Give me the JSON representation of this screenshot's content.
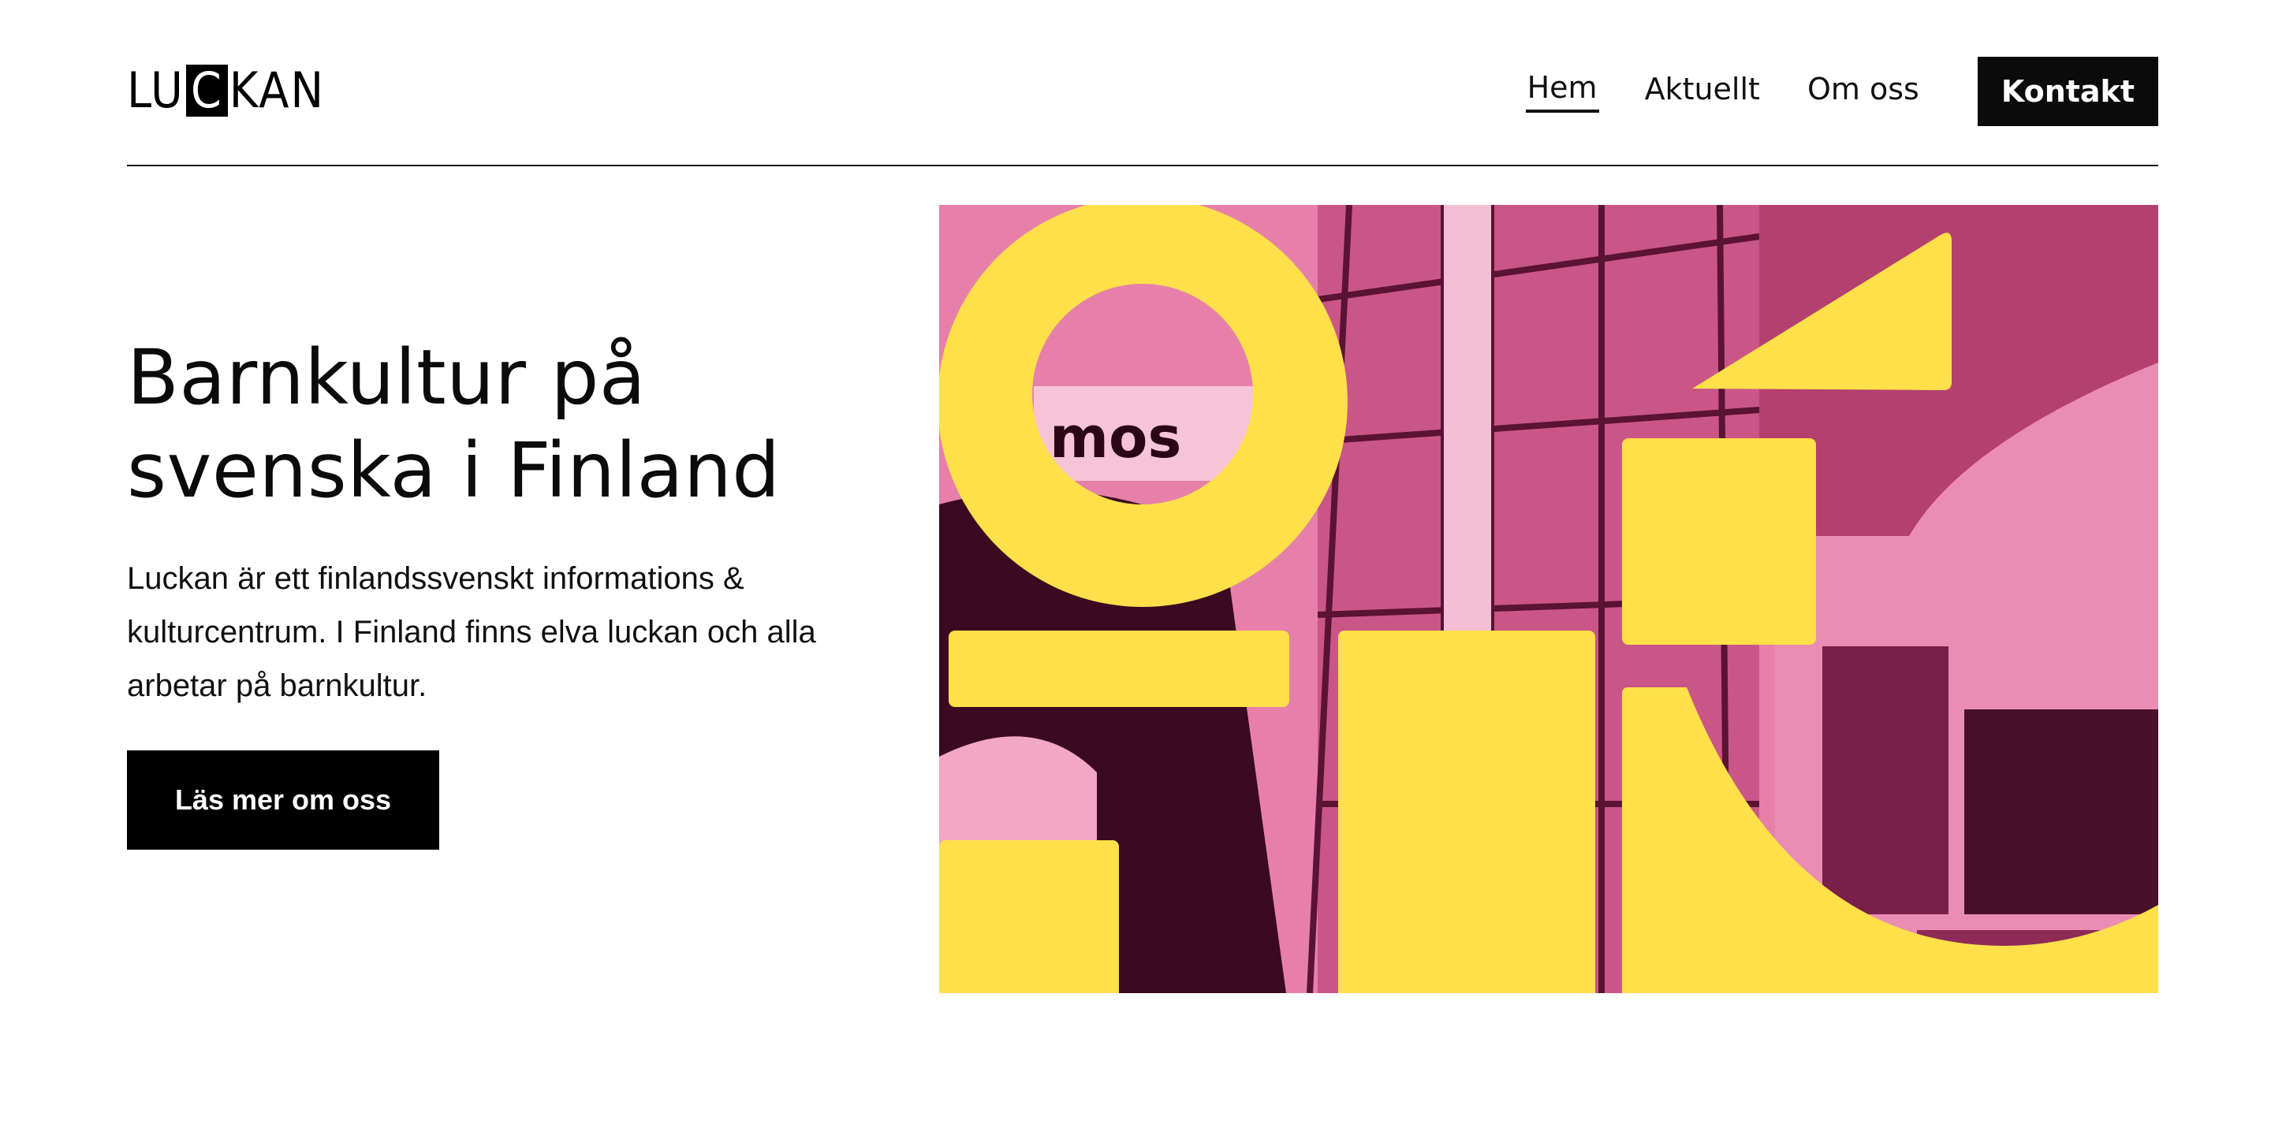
{
  "brand": {
    "logo_text_before": "LU",
    "logo_text_boxed": "C",
    "logo_text_after": "KAN"
  },
  "nav": {
    "items": [
      {
        "label": "Hem",
        "active": true
      },
      {
        "label": "Aktuellt",
        "active": false
      },
      {
        "label": "Om oss",
        "active": false
      }
    ],
    "cta_label": "Kontakt"
  },
  "hero": {
    "title_line1": "Barnkultur på",
    "title_line2": "svenska i Finland",
    "description": "Luckan är ett finlandssvenskt informations & kulturcentrum. I Finland finns elva luckan och alla arbetar på barnkultur.",
    "button_label": "Läs mer om oss",
    "image_sign_text": "mos"
  },
  "colors": {
    "accent_yellow": "#ffe04a",
    "photo_pink": "#e780a8",
    "photo_dark": "#7a1f48",
    "text": "#0b0b0b"
  }
}
